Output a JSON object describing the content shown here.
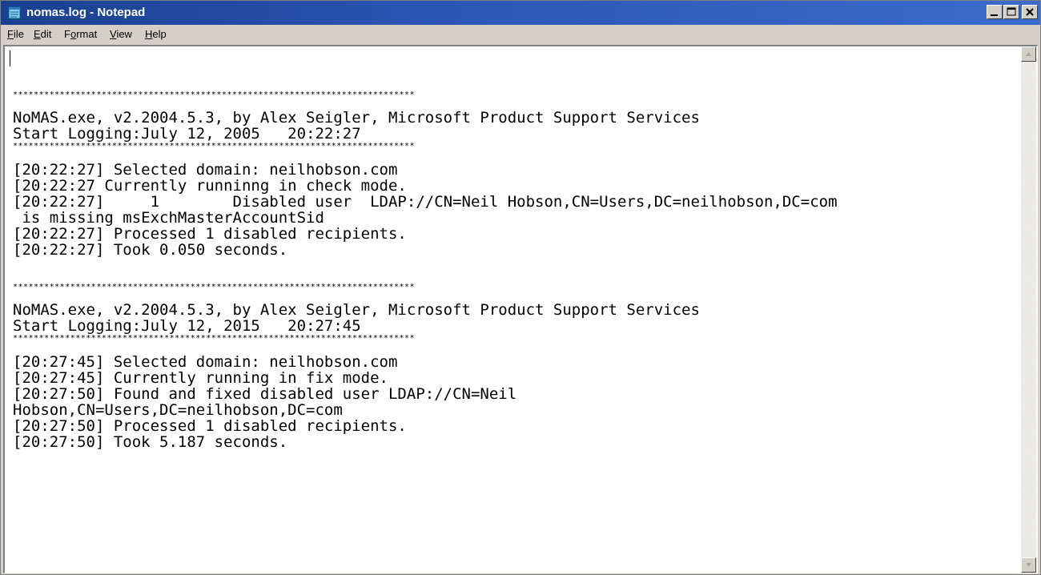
{
  "window": {
    "title": "nomas.log - Notepad",
    "title_bar_color": "#1b3f8f",
    "icon": "notepad-icon",
    "controls": [
      "minimize-icon",
      "maximize-icon",
      "close-icon"
    ]
  },
  "menu": {
    "items": [
      {
        "label": "File",
        "mnemonic": "F"
      },
      {
        "label": "Edit",
        "mnemonic": "E"
      },
      {
        "label": "Format",
        "mnemonic": "o"
      },
      {
        "label": "View",
        "mnemonic": "V"
      },
      {
        "label": "Help",
        "mnemonic": "H"
      }
    ]
  },
  "editor": {
    "lines": [
      "*****************************************************************************",
      "NoMAS.exe, v2.2004.5.3, by Alex Seigler, Microsoft Product Support Services",
      "Start Logging:July 12, 2005   20:22:27",
      "*****************************************************************************",
      "[20:22:27] Selected domain: neilhobson.com",
      "[20:22:27 Currently runninng in check mode.",
      "[20:22:27]     1        Disabled user  LDAP://CN=Neil Hobson,CN=Users,DC=neilhobson,DC=com",
      " is missing msExchMasterAccountSid",
      "[20:22:27] Processed 1 disabled recipients.",
      "[20:22:27] Took 0.050 seconds.",
      "",
      "*****************************************************************************",
      "NoMAS.exe, v2.2004.5.3, by Alex Seigler, Microsoft Product Support Services",
      "Start Logging:July 12, 2015   20:27:45",
      "*****************************************************************************",
      "[20:27:45] Selected domain: neilhobson.com",
      "[20:27:45] Currently running in fix mode.",
      "[20:27:50] Found and fixed disabled user LDAP://CN=Neil",
      "Hobson,CN=Users,DC=neilhobson,DC=com",
      "[20:27:50] Processed 1 disabled recipients.",
      "[20:27:50] Took 5.187 seconds."
    ]
  },
  "scrollbar": {
    "up_icon": "scroll-up-arrow-icon",
    "down_icon": "scroll-down-arrow-icon"
  }
}
